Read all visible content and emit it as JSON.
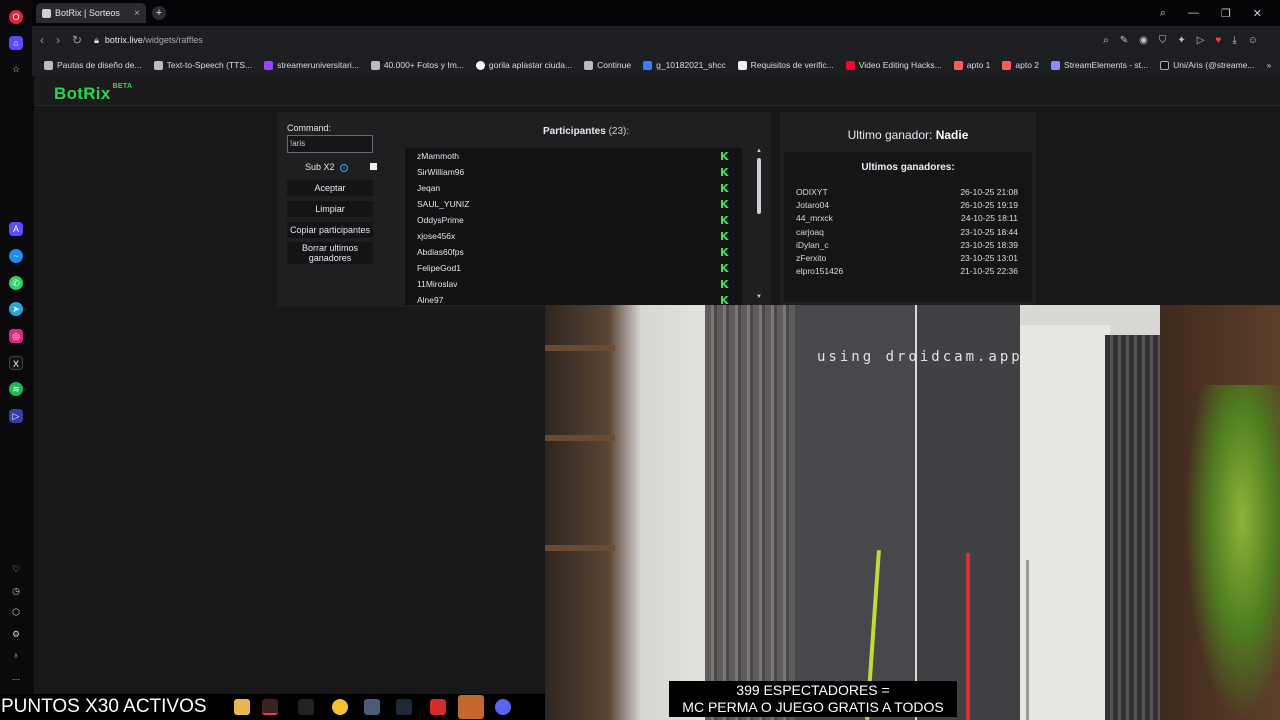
{
  "browser": {
    "tab_title": "BotRix | Sorteos",
    "new_tab_label": "+",
    "url_domain": "botrix.live",
    "url_path": "/widgets/raffles",
    "bookmarks": [
      "Pautas de diseño de...",
      "Text-to-Speech (TTS...",
      "streameruniversitari...",
      "40.000+ Fotos y Im...",
      "gorila aplastar ciuda...",
      "Continue",
      "g_10182021_shcc",
      "Requisitos de verific...",
      "Video Editing Hacks...",
      "apto 1",
      "apto 2",
      "StreamElements - st...",
      "Uni/Aris (@streame..."
    ],
    "more_bookmarks": "»"
  },
  "app": {
    "logo": "BotRix",
    "logo_badge": "BETA"
  },
  "raffle": {
    "command_label": "Command:",
    "command_value": "!aris",
    "sub_multiplier_label": "Sub X2",
    "accept_label": "Aceptar",
    "clear_label": "Limpiar",
    "copy_label": "Copiar participantes",
    "delete_winners_label": "Borrar ultimos ganadores",
    "participants_title": "Participantes",
    "participants_count": "(23):",
    "participants": [
      "zMammoth",
      "SirWilliam96",
      "Jeqan",
      "SAUL_YUNIZ",
      "OddysPrime",
      "xjose456x",
      "Abdias60fps",
      "FelipeGod1",
      "11Miroslav",
      "Alne97"
    ],
    "platform_icon_text": "K"
  },
  "winners": {
    "last_winner_prefix": "Ultimo ganador:",
    "last_winner_name": "Nadie",
    "history_title": "Ultimos ganadores:",
    "history": [
      {
        "name": "ODIXYT",
        "date": "26-10-25 21:08"
      },
      {
        "name": "Jotaro04",
        "date": "26-10-25 19:19"
      },
      {
        "name": "44_mrxck",
        "date": "24-10-25 18:11"
      },
      {
        "name": "carjoaq",
        "date": "23-10-25 18:44"
      },
      {
        "name": "iDylan_c",
        "date": "23-10-25 18:39"
      },
      {
        "name": "zFerxito",
        "date": "23-10-25 13:01"
      },
      {
        "name": "elpro151426",
        "date": "21-10-25 22:36"
      }
    ]
  },
  "overlay": {
    "droidcam_watermark": "using droidcam.app",
    "subtitle_line1": "399 ESPECTADORES =",
    "subtitle_line2": "MC PERMA O JUEGO GRATIS A TODOS",
    "ticker": "PUNTOS X30 ACTIVOS"
  }
}
